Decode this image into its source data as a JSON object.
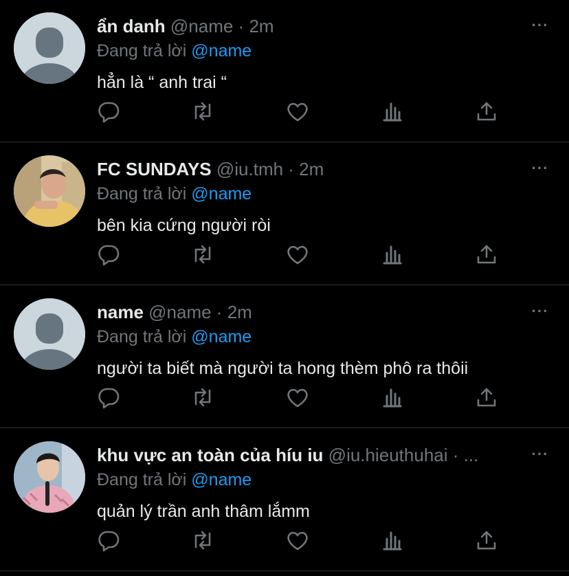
{
  "colors": {
    "background": "#000000",
    "text": "#e7e9ea",
    "muted": "#71767b",
    "link": "#1d9bf0",
    "divider": "#2f3336"
  },
  "tweets": [
    {
      "name": "ẩn danh",
      "meta": "@name · 2m",
      "replying_label": "Đang trả lời",
      "replying_handle": "@name",
      "text": "hẳn là “ anh trai “",
      "avatar": "default-avatar",
      "more": "···"
    },
    {
      "name": "FC SUNDAYS",
      "meta": "@iu.tmh · 2m",
      "replying_label": "Đang trả lời",
      "replying_handle": "@name",
      "text": "bên kia cứng người ròi",
      "avatar": "photo-avatar",
      "more": "···"
    },
    {
      "name": "name",
      "meta": "@name · 2m",
      "replying_label": "Đang trả lời",
      "replying_handle": "@name",
      "text": "người ta biết mà người ta hong thèm phô ra thôii",
      "avatar": "default-avatar",
      "more": "···"
    },
    {
      "name": "khu vực an toàn của híu iu",
      "meta": "@iu.hieuthuhai · ...",
      "replying_label": "Đang trả lời",
      "replying_handle": "@name",
      "text": "quản lý trần anh thâm lắmm",
      "avatar": "photo-avatar",
      "more": "···"
    }
  ],
  "actions": [
    "reply-icon",
    "retweet-icon",
    "like-icon",
    "analytics-icon",
    "share-icon"
  ]
}
